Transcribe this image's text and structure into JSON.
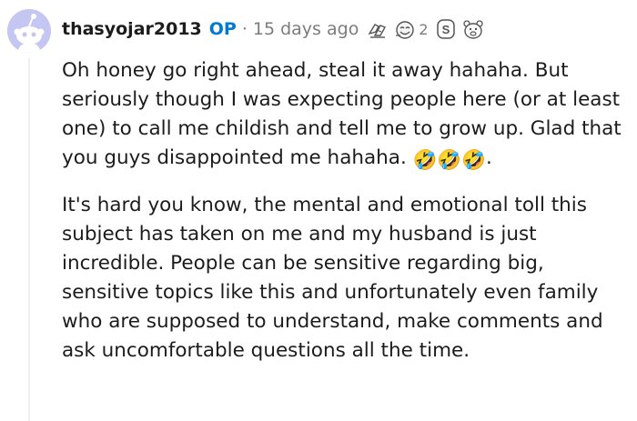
{
  "comment": {
    "author": "thasyojar2013",
    "op_badge": "OP",
    "separator": "·",
    "time": "15 days ago",
    "awards": [
      {
        "icon": "hands-award-icon"
      },
      {
        "icon": "smile-award-icon",
        "count": "2"
      },
      {
        "icon": "s-coin-award-icon"
      },
      {
        "icon": "bear-award-icon"
      }
    ],
    "paragraphs": [
      "Oh honey go right ahead, steal it away hahaha. But seriously though I was expecting people here (or at least one) to call me childish and tell me to grow up. Glad that you guys disappointed me hahaha.",
      "It's hard you know, the mental and emotional toll this subject has taken on me and my husband is just incredible. People can be sensitive regarding big, sensitive topics like this and unfortunately even family who are supposed to understand, make comments and ask uncomfortable questions all the time."
    ],
    "emoji_tail": "🤣🤣🤣",
    "emoji_end": "."
  },
  "colors": {
    "op_blue": "#0079d3",
    "meta_gray": "#7c7c7c",
    "avatar_bg": "#c6c6f3",
    "thread_line": "#edeff1"
  }
}
